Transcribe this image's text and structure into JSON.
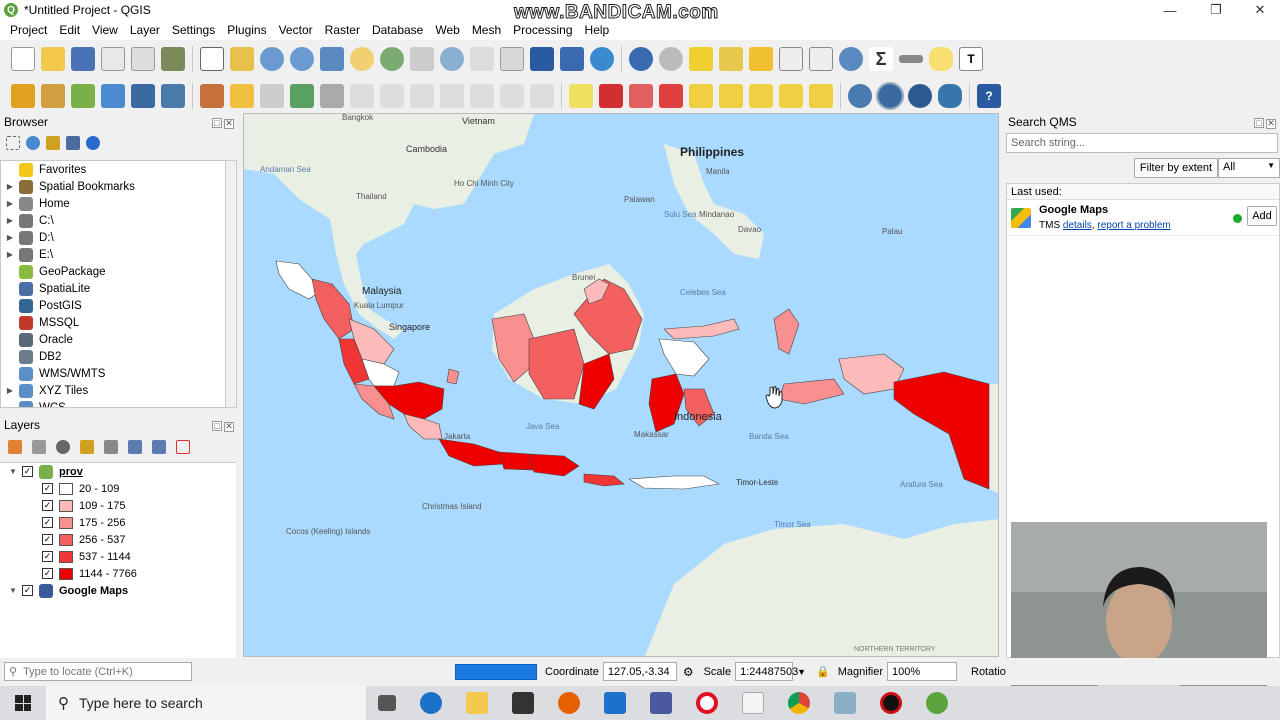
{
  "window": {
    "title": "*Untitled Project - QGIS",
    "watermark": "www.BANDICAM.com"
  },
  "menu": [
    "Project",
    "Edit",
    "View",
    "Layer",
    "Settings",
    "Plugins",
    "Vector",
    "Raster",
    "Database",
    "Web",
    "Mesh",
    "Processing",
    "Help"
  ],
  "browser": {
    "title": "Browser",
    "items": [
      {
        "label": "Favorites",
        "icon": "star-icon",
        "color": "#f5c518",
        "expandable": false
      },
      {
        "label": "Spatial Bookmarks",
        "icon": "bookmark-icon",
        "color": "#8a6d3b",
        "expandable": true
      },
      {
        "label": "Home",
        "icon": "home-folder-icon",
        "color": "#888888",
        "expandable": true
      },
      {
        "label": "C:\\",
        "icon": "drive-icon",
        "color": "#777777",
        "expandable": true
      },
      {
        "label": "D:\\",
        "icon": "drive-icon",
        "color": "#777777",
        "expandable": true
      },
      {
        "label": "E:\\",
        "icon": "drive-icon",
        "color": "#777777",
        "expandable": true
      },
      {
        "label": "GeoPackage",
        "icon": "geopackage-icon",
        "color": "#8ab93f",
        "expandable": false
      },
      {
        "label": "SpatiaLite",
        "icon": "spatialite-icon",
        "color": "#4a6fa5",
        "expandable": false
      },
      {
        "label": "PostGIS",
        "icon": "postgis-icon",
        "color": "#336791",
        "expandable": false
      },
      {
        "label": "MSSQL",
        "icon": "mssql-icon",
        "color": "#c0392b",
        "expandable": false
      },
      {
        "label": "Oracle",
        "icon": "oracle-icon",
        "color": "#5a6a7a",
        "expandable": false
      },
      {
        "label": "DB2",
        "icon": "db2-icon",
        "color": "#6b7b8b",
        "expandable": false
      },
      {
        "label": "WMS/WMTS",
        "icon": "globe-icon",
        "color": "#5b8fc7",
        "expandable": false
      },
      {
        "label": "XYZ Tiles",
        "icon": "xyz-tiles-icon",
        "color": "#5b8fc7",
        "expandable": true
      },
      {
        "label": "WCS",
        "icon": "globe-icon",
        "color": "#5b8fc7",
        "expandable": false
      }
    ]
  },
  "layers": {
    "title": "Layers",
    "group": "prov",
    "classes": [
      {
        "label": "20 - 109",
        "color": "#ffffff"
      },
      {
        "label": "109 - 175",
        "color": "#fcbaba"
      },
      {
        "label": "175 - 256",
        "color": "#f99090"
      },
      {
        "label": "256 - 537",
        "color": "#f46060"
      },
      {
        "label": "537 - 1144",
        "color": "#f03535"
      },
      {
        "label": "1144 - 7766",
        "color": "#ee0000"
      }
    ],
    "basemap": "Google Maps"
  },
  "map": {
    "labels": [
      "Vietnam",
      "Bangkok",
      "Cambodia",
      "Philippines",
      "Ho Chi Minh City",
      "Manila",
      "Palawan",
      "Sulu Sea",
      "Mindanao",
      "Davao",
      "Palau",
      "Brunei",
      "Celebes Sea",
      "Malaysia",
      "Kuala Lumpur",
      "Singapore",
      "Indonesia",
      "Banda Sea",
      "Java Sea",
      "Jakarta",
      "Makassar",
      "Timor-Leste",
      "Timor Sea",
      "Arafura Sea",
      "Christmas Island",
      "Cocos (Keeling) Islands",
      "NORTHERN TERRITORY",
      "Andaman Sea",
      "Thailand"
    ]
  },
  "qms": {
    "title": "Search QMS",
    "search_placeholder": "Search string...",
    "filter_button": "Filter by extent",
    "filter_value": "All",
    "last_used_label": "Last used:",
    "service": {
      "name": "Google Maps",
      "type": "TMS",
      "details": "details",
      "report": "report a problem",
      "add": "Add",
      "status_color": "#1aaa2a"
    }
  },
  "status": {
    "locate_placeholder": "Type to locate (Ctrl+K)",
    "coordinate_label": "Coordinate",
    "coordinate_value": "127.05,-3.34",
    "scale_label": "Scale",
    "scale_value": "1:24487503",
    "magnifier_label": "Magnifier",
    "magnifier_value": "100%",
    "rotation_label": "Rotatio"
  },
  "taskbar": {
    "search_placeholder": "Type here to search"
  }
}
